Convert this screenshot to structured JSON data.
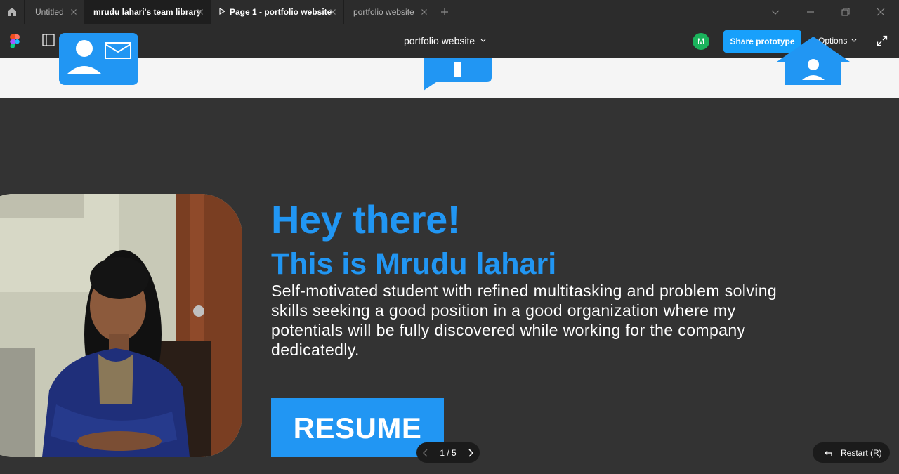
{
  "tabs": [
    {
      "label": "Untitled",
      "active": false
    },
    {
      "label": "mrudu lahari's team library",
      "active": true
    },
    {
      "label": "Page 1 - portfolio website",
      "active": false,
      "play": true
    },
    {
      "label": "portfolio website",
      "active": false
    }
  ],
  "toolbar": {
    "file_title": "portfolio website",
    "avatar_initial": "M",
    "share_label": "Share prototype",
    "options_label": "Options"
  },
  "hero": {
    "greeting": "Hey there!",
    "name_line": "This is Mrudu lahari",
    "bio": "Self-motivated student with refined multitasking and problem solving skills seeking a good position in a good organization where my potentials will be fully discovered while working for the company dedicatedly.",
    "resume_label": "RESUME"
  },
  "navigation": {
    "page_counter": "1 / 5",
    "restart_label": "Restart (R)"
  },
  "nav_icons": [
    "contact-card-icon",
    "info-chat-icon",
    "home-user-icon"
  ],
  "colors": {
    "accent": "#2196f3",
    "figma_blue": "#18a0fb",
    "background": "#333333",
    "chrome": "#2c2c2c",
    "avatar_green": "#1bb35c"
  }
}
